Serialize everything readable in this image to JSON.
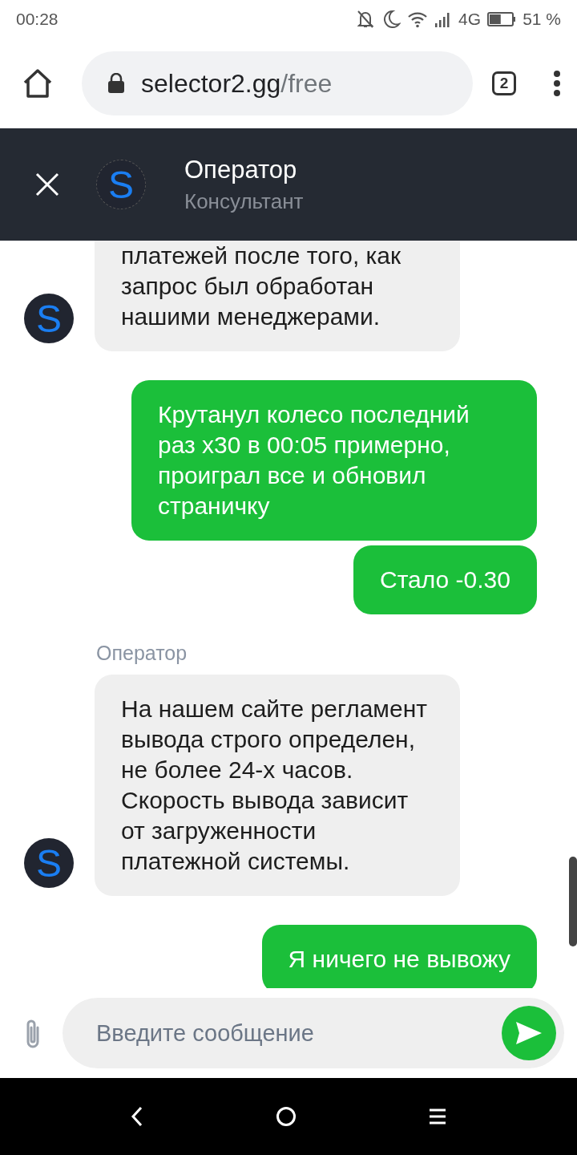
{
  "status_bar": {
    "time": "00:28",
    "network": "4G",
    "battery": "51 %"
  },
  "browser": {
    "url_host": "selector2.gg",
    "url_path": "/free",
    "tab_count": "2"
  },
  "chat_header": {
    "avatar_letter": "S",
    "name": "Оператор",
    "role": "Консультант"
  },
  "messages": [
    {
      "kind": "incoming",
      "text": "платежей после того, как запрос был обработан нашими менеджерами.",
      "clipped_top": true,
      "avatar_letter": "S"
    },
    {
      "kind": "outgoing",
      "text": "Крутанул колесо последний раз x30 в 00:05 примерно, проиграл все и обновил страничку"
    },
    {
      "kind": "outgoing",
      "text": "Стало -0.30"
    },
    {
      "kind": "incoming",
      "author": "Оператор",
      "text": "На нашем сайте регламент вывода строго определен, не более 24-х часов. Скорость вывода зависит от загруженности платежной системы.",
      "avatar_letter": "S"
    },
    {
      "kind": "outgoing",
      "text": "Я ничего не вывожу"
    }
  ],
  "composer": {
    "placeholder": "Введите сообщение"
  }
}
